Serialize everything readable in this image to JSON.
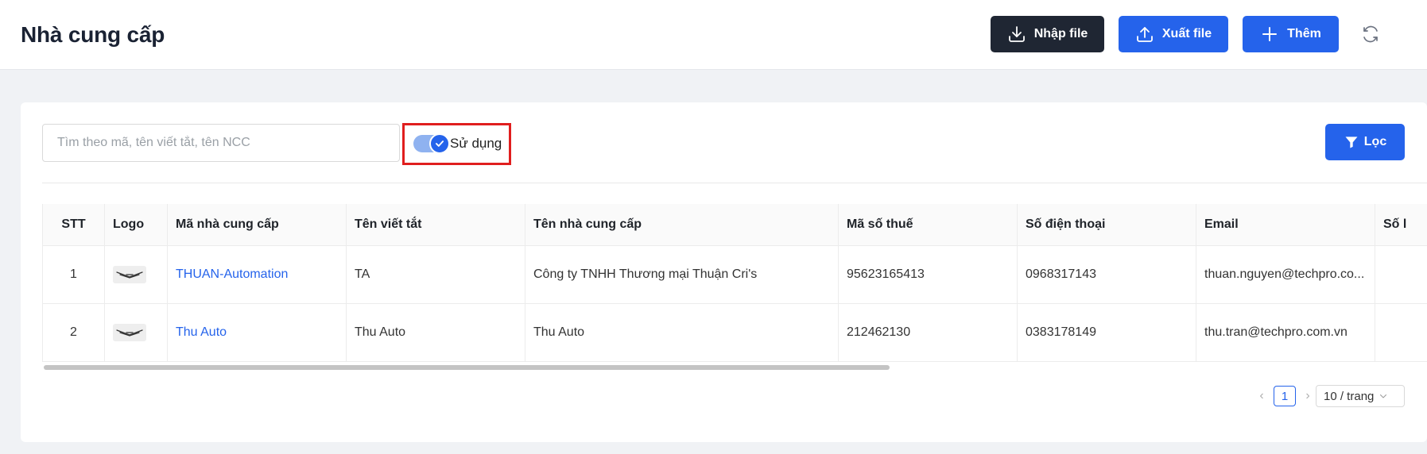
{
  "header": {
    "title": "Nhà cung cấp",
    "import_label": "Nhập file",
    "export_label": "Xuất file",
    "add_label": "Thêm"
  },
  "filters": {
    "search_placeholder": "Tìm theo mã, tên viết tắt, tên NCC",
    "search_value": "",
    "active_toggle_label": "Sử dụng",
    "active_toggle_on": true,
    "filter_label": "Lọc"
  },
  "table": {
    "columns": [
      "STT",
      "Logo",
      "Mã nhà cung cấp",
      "Tên viết tắt",
      "Tên nhà cung cấp",
      "Mã số thuế",
      "Số điện thoại",
      "Email",
      "Số l"
    ],
    "rows": [
      {
        "stt": "1",
        "code": "THUAN-Automation",
        "short_name": "TA",
        "name": "Công ty TNHH Thương mại Thuận Cri's",
        "tax_code": "95623165413",
        "phone": "0968317143",
        "email": "thuan.nguyen@techpro.co..."
      },
      {
        "stt": "2",
        "code": "Thu Auto",
        "short_name": "Thu Auto",
        "name": "Thu Auto",
        "tax_code": "212462130",
        "phone": "0383178149",
        "email": "thu.tran@techpro.com.vn"
      }
    ]
  },
  "pagination": {
    "current_page": "1",
    "page_size_label": "10 / trang"
  },
  "icons": {
    "import": "download-icon",
    "export": "upload-icon",
    "add": "plus-icon",
    "refresh": "refresh-icon",
    "filter": "filter-icon",
    "logo": "wings-logo-icon"
  },
  "colors": {
    "primary": "#2563eb",
    "dark_button": "#1f2633",
    "highlight": "#e01e1e"
  }
}
